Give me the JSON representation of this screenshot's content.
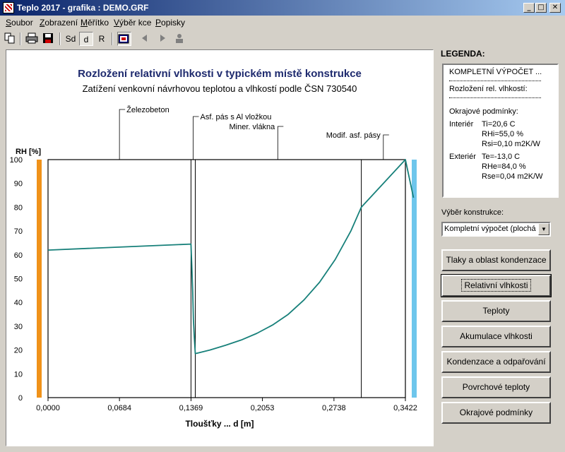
{
  "window": {
    "title": "Teplo 2017 - grafika : DEMO.GRF",
    "minimize": "_",
    "maximize": "□",
    "close": "✕"
  },
  "menu": [
    {
      "label": "Soubor",
      "hotkey": "S",
      "rest": "oubor"
    },
    {
      "label": "Zobrazení",
      "hotkey": "Z",
      "rest": "obrazení"
    },
    {
      "label": "Měřítko",
      "hotkey": "M",
      "rest": "ěřítko"
    },
    {
      "label": "Výběr kce",
      "hotkey": "V",
      "rest": "ýběr kce"
    },
    {
      "label": "Popisky",
      "hotkey": "P",
      "rest": "opisky"
    }
  ],
  "toolbar": {
    "sd_label": "Sd",
    "d_label": "d",
    "r_label": "R",
    "icons": [
      "copy-icon",
      "print-icon",
      "save-icon",
      "export-icon",
      "back-icon",
      "forward-icon",
      "user-icon"
    ]
  },
  "colors": {
    "line": "#17807a",
    "interior": "#f0921a",
    "exterior": "#6ec6ec",
    "title": "#1e2a6e"
  },
  "chart_data": {
    "type": "line",
    "title": "Rozložení relativní vlhkosti v typickém místě konstrukce",
    "subtitle": "Zatížení venkovní návrhovou teplotou a vlhkostí podle ČSN 730540",
    "xlabel": "Tloušťky ... d [m]",
    "ylabel": "RH [%]",
    "xlim": [
      0,
      0.3422
    ],
    "ylim": [
      0,
      100
    ],
    "x_ticks": [
      "0,0000",
      "0,0684",
      "0,1369",
      "0,2053",
      "0,2738",
      "0,3422"
    ],
    "y_ticks": [
      "0",
      "10",
      "20",
      "30",
      "40",
      "50",
      "60",
      "70",
      "80",
      "90",
      "100"
    ],
    "layer_boundaries": [
      0,
      0.1369,
      0.141,
      0.3,
      0.3422
    ],
    "layer_labels": [
      {
        "text": "Železobeton",
        "x": 0.0684
      },
      {
        "text": "Asf. pás s Al vložkou",
        "x": 0.139
      },
      {
        "text": "Miner. vlákna",
        "x": 0.22
      },
      {
        "text": "Modif. asf. pásy",
        "x": 0.3211
      }
    ],
    "series": [
      {
        "x": [
          0,
          0.1369,
          0.1376,
          0.1385,
          0.1392,
          0.14,
          0.141,
          0.155,
          0.17,
          0.185,
          0.2,
          0.215,
          0.23,
          0.245,
          0.26,
          0.275,
          0.29,
          0.3,
          0.3422,
          0.35
        ],
        "values": [
          62,
          64.5,
          56,
          45,
          33,
          26,
          18.5,
          20,
          22,
          24.2,
          27,
          30.5,
          35,
          41,
          48.5,
          58,
          70,
          80,
          100,
          84
        ]
      }
    ]
  },
  "legend": {
    "heading": "LEGENDA:",
    "title": "KOMPLETNÍ VÝPOČET ...",
    "subtitle": "Rozložení rel. vlhkostí:",
    "conditions": "Okrajové podmínky:",
    "interior_label": "Interiér",
    "interior_values": [
      "Ti=20,6 C",
      "RHi=55,0 %",
      "Rsi=0,10 m2K/W"
    ],
    "exterior_label": "Exteriér",
    "exterior_values": [
      "Te=-13,0 C",
      "RHe=84,0 %",
      "Rse=0,04 m2K/W"
    ]
  },
  "selector": {
    "label": "Výběr konstrukce:",
    "value": "Kompletní výpočet (plochá s"
  },
  "buttons": [
    {
      "label": "Tlaky a oblast kondenzace",
      "name": "pressure-button"
    },
    {
      "label": "Relativní vlhkosti",
      "name": "relative-humidity-button",
      "active": true
    },
    {
      "label": "Teploty",
      "name": "temperatures-button"
    },
    {
      "label": "Akumulace vlhkosti",
      "name": "moisture-accumulation-button"
    },
    {
      "label": "Kondenzace a odpařování",
      "name": "condensation-evaporation-button"
    },
    {
      "label": "Povrchové teploty",
      "name": "surface-temperatures-button"
    },
    {
      "label": "Okrajové podmínky",
      "name": "boundary-conditions-button"
    }
  ]
}
